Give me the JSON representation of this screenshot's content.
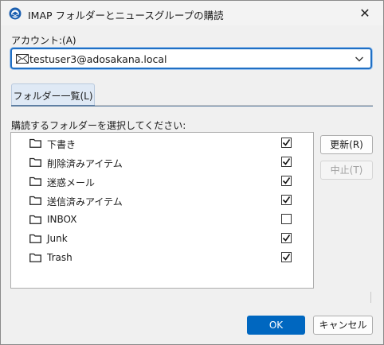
{
  "window": {
    "title": "IMAP フォルダーとニュースグループの購読",
    "close_glyph": "✕"
  },
  "account": {
    "label": "アカウント:(A)",
    "value": "testuser3@adosakana.local",
    "icon": "mail-account-icon"
  },
  "tabs": [
    {
      "label": "フォルダー一覧(L)",
      "selected": true
    }
  ],
  "folders": {
    "label": "購読するフォルダーを選択してください:",
    "items": [
      {
        "name": "下書き",
        "subscribed": true
      },
      {
        "name": "削除済みアイテム",
        "subscribed": true
      },
      {
        "name": "迷惑メール",
        "subscribed": true
      },
      {
        "name": "送信済みアイテム",
        "subscribed": true
      },
      {
        "name": "INBOX",
        "subscribed": false
      },
      {
        "name": "Junk",
        "subscribed": true
      },
      {
        "name": "Trash",
        "subscribed": true
      }
    ]
  },
  "buttons": {
    "refresh": "更新(R)",
    "stop": "中止(T)",
    "ok": "OK",
    "cancel": "キャンセル"
  },
  "colors": {
    "accent": "#0067c0",
    "focus_border": "#1f6fc4",
    "tab_bg": "#dfe9f5"
  }
}
